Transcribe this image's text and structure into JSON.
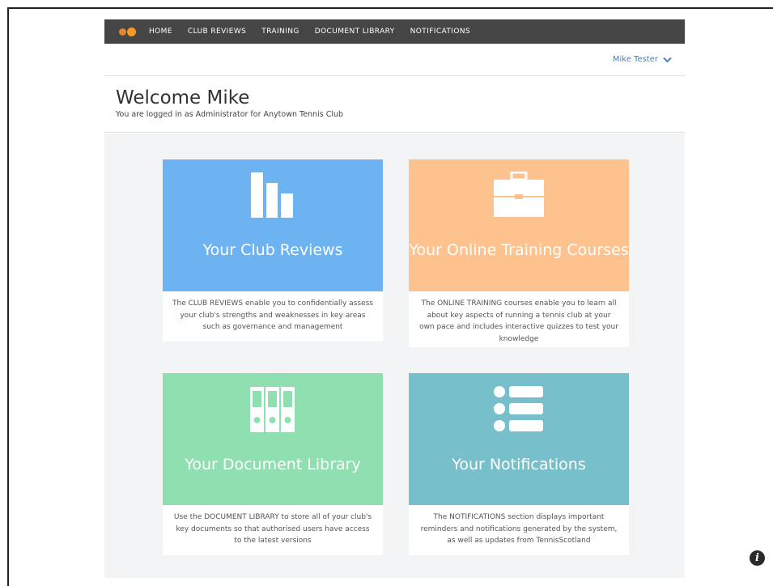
{
  "nav": {
    "items": [
      {
        "label": "HOME"
      },
      {
        "label": "CLUB REVIEWS"
      },
      {
        "label": "TRAINING"
      },
      {
        "label": "DOCUMENT LIBRARY"
      },
      {
        "label": "NOTIFICATIONS"
      }
    ]
  },
  "user": {
    "name": "Mike Tester"
  },
  "welcome": {
    "heading": "Welcome Mike",
    "subtext": "You are logged in as Administrator for Anytown Tennis Club"
  },
  "cards": [
    {
      "title": "Your Club Reviews",
      "icon": "bar-chart-icon",
      "color": "#6db3f2",
      "description": "The CLUB REVIEWS enable you to confidentially assess your club's strengths and weaknesses in key areas such as governance and management"
    },
    {
      "title": "Your Online Training Courses",
      "icon": "briefcase-icon",
      "color": "#fdc28e",
      "description": "The ONLINE TRAINING courses enable you to learn all about key aspects of running a tennis club at your own pace and includes interactive quizzes to test your knowledge"
    },
    {
      "title": "Your Document Library",
      "icon": "binders-icon",
      "color": "#8fdfb0",
      "description": "Use the DOCUMENT LIBRARY to store all of your club's key documents so that authorised users have access to the latest versions"
    },
    {
      "title": "Your Notifications",
      "icon": "list-icon",
      "color": "#76bfcb",
      "description": "The NOTIFICATIONS section displays important reminders and notifications generated by the system, as well as updates from TennisScotland"
    }
  ],
  "colors": {
    "nav_bg": "#454545",
    "logo": "#f39a2f",
    "link": "#4a7fb7",
    "content_bg": "#f2f4f6"
  }
}
